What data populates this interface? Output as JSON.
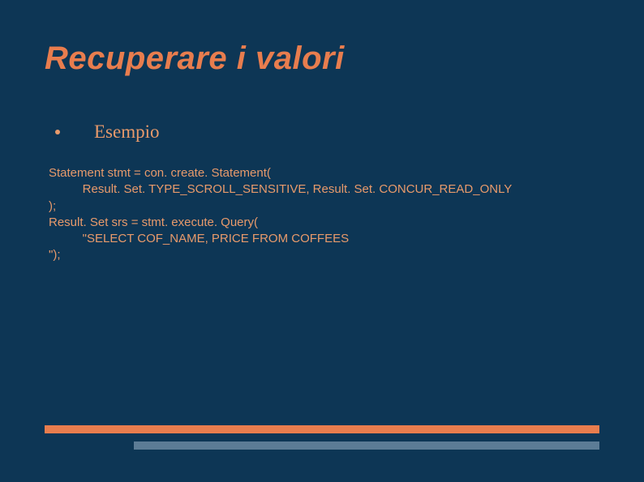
{
  "title": "Recuperare i valori",
  "bullet": {
    "label": "Esempio"
  },
  "code": {
    "line1": "Statement stmt = con. create. Statement(",
    "line2": "          Result. Set. TYPE_SCROLL_SENSITIVE, Result. Set. CONCUR_READ_ONLY",
    "line3": ");",
    "line4": "Result. Set srs = stmt. execute. Query(",
    "line5": "          \"SELECT COF_NAME, PRICE FROM COFFEES",
    "line6": "\");"
  }
}
